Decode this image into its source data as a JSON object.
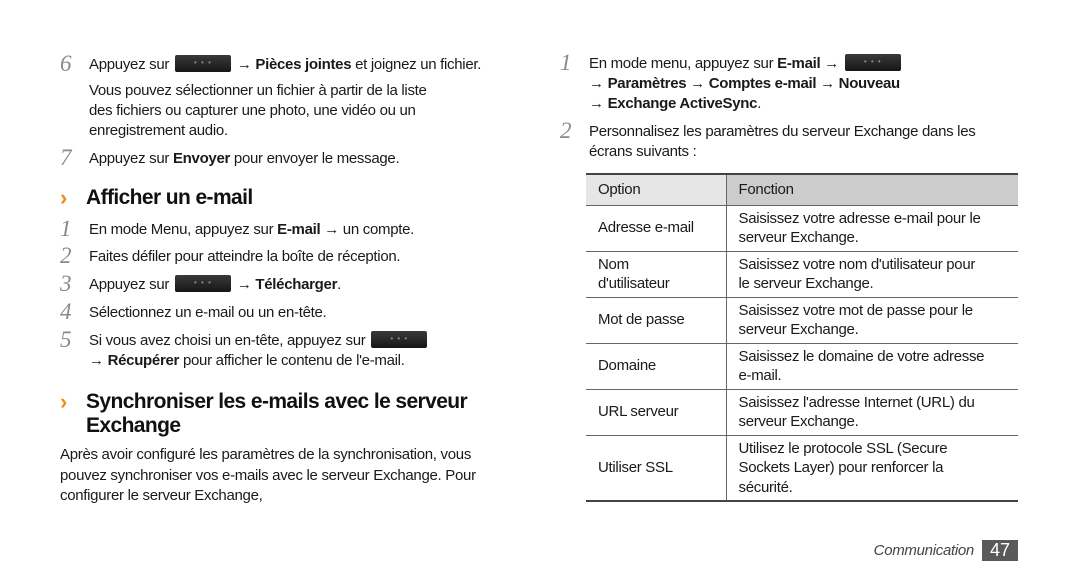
{
  "left": {
    "steps_top": [
      {
        "num": "6",
        "parts": [
          {
            "text": "Appuyez sur ",
            "bold": false
          },
          {
            "key": "menu-key"
          },
          {
            "text": " → Pièces jointes",
            "bold": true
          },
          {
            "text": " et joignez un fichier.",
            "bold": false
          }
        ],
        "extra_lines": [
          "Vous pouvez sélectionner un fichier à partir de la liste",
          "des fichiers ou capturer une photo, une vidéo ou un",
          "enregistrement audio."
        ]
      },
      {
        "num": "7",
        "parts": [
          {
            "text": "Appuyez sur ",
            "bold": false
          },
          {
            "text": "Envoyer",
            "bold": true
          },
          {
            "text": " pour envoyer le message.",
            "bold": false
          }
        ]
      }
    ],
    "section1": {
      "chevron": "›",
      "title": "Afficher un e-mail",
      "steps": [
        {
          "num": "1",
          "parts": [
            {
              "text": "En mode Menu, appuyez sur ",
              "bold": false
            },
            {
              "text": "E-mail",
              "bold": true
            },
            {
              "text": " → un compte.",
              "bold": false
            }
          ]
        },
        {
          "num": "2",
          "parts": [
            {
              "text": "Faites défiler pour atteindre la boîte de réception.",
              "bold": false
            }
          ]
        },
        {
          "num": "3",
          "parts": [
            {
              "text": "Appuyez sur ",
              "bold": false
            },
            {
              "key": "menu-key"
            },
            {
              "text": " → Télécharger",
              "bold": true
            },
            {
              "text": ".",
              "bold": false
            }
          ]
        },
        {
          "num": "4",
          "parts": [
            {
              "text": "Sélectionnez un e-mail ou un en-tête.",
              "bold": false
            }
          ]
        },
        {
          "num": "5",
          "parts": [
            {
              "text": "Si vous avez choisi un en-tête, appuyez sur ",
              "bold": false
            },
            {
              "key": "menu-key"
            }
          ],
          "line2": [
            {
              "text": "→ ",
              "bold": false
            },
            {
              "text": "Récupérer",
              "bold": true
            },
            {
              "text": " pour afficher le contenu de l'e-mail.",
              "bold": false
            }
          ]
        }
      ]
    },
    "section2": {
      "chevron": "›",
      "title_lines": [
        "Synchroniser les e-mails avec le serveur",
        "Exchange"
      ],
      "paragraph_lines": [
        "Après avoir configuré les paramètres de la synchronisation, vous",
        "pouvez synchroniser vos e-mails avec le serveur Exchange. Pour",
        "configurer le serveur Exchange,"
      ]
    },
    "menu_key_dots": "• • •"
  },
  "right": {
    "step1": {
      "num": "1",
      "line1": [
        {
          "text": "En mode menu, appuyez sur ",
          "bold": false
        },
        {
          "text": "E-mail",
          "bold": true
        },
        {
          "text": " → ",
          "bold": false
        },
        {
          "key": "menu-key"
        }
      ],
      "line2": "→ Paramètres → Comptes e-mail → Nouveau",
      "line3_bold": "→ Exchange ActiveSync",
      "line3_end": "."
    },
    "step2": {
      "num": "2",
      "lines": [
        "Personnalisez les paramètres du serveur Exchange dans les",
        "écrans suivants :"
      ]
    },
    "table": {
      "headers": [
        "Option",
        "Fonction"
      ],
      "rows": [
        {
          "option": [
            "Adresse e-mail"
          ],
          "fonction": [
            "Saisissez votre adresse e-mail pour le",
            "serveur Exchange."
          ]
        },
        {
          "option": [
            "Nom",
            "d'utilisateur"
          ],
          "fonction": [
            "Saisissez votre nom d'utilisateur pour",
            "le serveur Exchange."
          ]
        },
        {
          "option": [
            "Mot de passe"
          ],
          "fonction": [
            "Saisissez votre mot de passe pour le",
            "serveur Exchange."
          ]
        },
        {
          "option": [
            "Domaine"
          ],
          "fonction": [
            "Saisissez le domaine de votre adresse",
            "e-mail."
          ]
        },
        {
          "option": [
            "URL serveur"
          ],
          "fonction": [
            "Saisissez l'adresse Internet (URL) du",
            "serveur Exchange."
          ]
        },
        {
          "option": [
            "Utiliser SSL"
          ],
          "fonction": [
            "Utilisez le protocole SSL (Secure",
            "Sockets Layer) pour renforcer la",
            "sécurité."
          ]
        }
      ]
    }
  },
  "footer": {
    "section": "Communication",
    "page": "47"
  },
  "colors": {
    "accent_chevron": "#f28a1e",
    "step_number": "#8a8a8a",
    "page_badge": "#595959",
    "table_header_option": "#e6e6e6",
    "table_header_fonction": "#cccccc"
  }
}
